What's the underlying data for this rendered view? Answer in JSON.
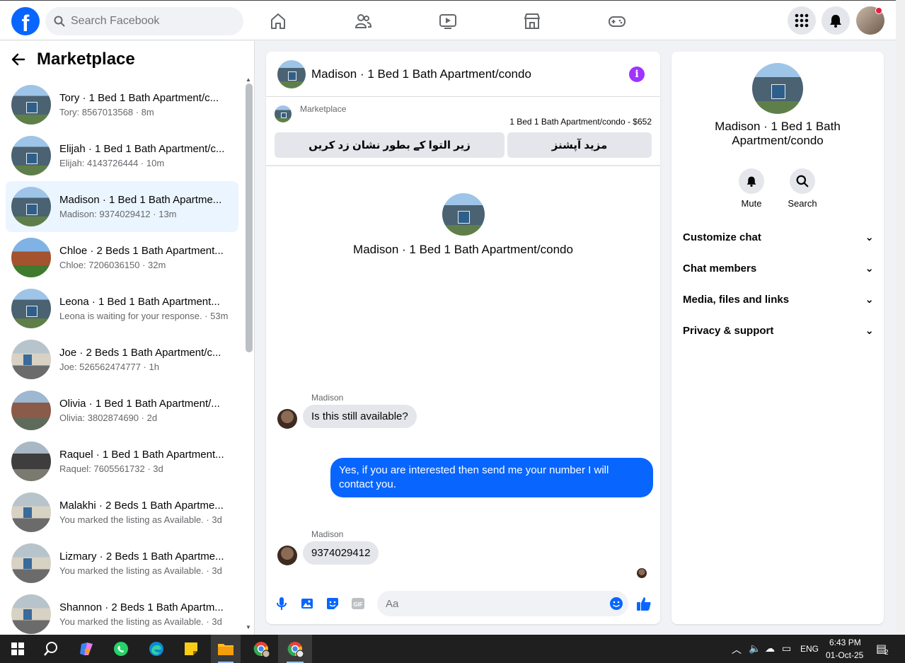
{
  "topbar": {
    "search_placeholder": "Search Facebook",
    "nav_icons": [
      "home-icon",
      "friends-icon",
      "video-icon",
      "marketplace-icon",
      "gaming-icon"
    ],
    "brand_color": "#0866ff"
  },
  "sidebar": {
    "title": "Marketplace",
    "conversations": [
      {
        "title": "Tory · 1 Bed 1 Bath Apartment/c...",
        "sub": "Tory: 8567013568 · 8m"
      },
      {
        "title": "Elijah · 1 Bed 1 Bath Apartment/c...",
        "sub": "Elijah: 4143726444 · 10m"
      },
      {
        "title": "Madison · 1 Bed 1 Bath Apartme...",
        "sub": "Madison: 9374029412 · 13m"
      },
      {
        "title": "Chloe · 2 Beds 1 Bath Apartment...",
        "sub": "Chloe: 7206036150 · 32m"
      },
      {
        "title": "Leona  · 1 Bed 1 Bath Apartment...",
        "sub": "Leona is waiting for your response. · 53m"
      },
      {
        "title": "Joe · 2 Beds 1 Bath Apartment/c...",
        "sub": "Joe: 526562474777 · 1h"
      },
      {
        "title": "Olivia · 1 Bed 1 Bath Apartment/...",
        "sub": "Olivia: 3802874690 · 2d"
      },
      {
        "title": "Raquel · 1 Bed 1 Bath Apartment...",
        "sub": "Raquel: 7605561732 · 3d"
      },
      {
        "title": "Malakhi · 2 Beds 1 Bath Apartme...",
        "sub": "You marked the listing as Available. · 3d"
      },
      {
        "title": "Lizmary · 2 Beds 1 Bath Apartme...",
        "sub": "You marked the listing as Available. · 3d"
      },
      {
        "title": "Shannon · 2 Beds 1 Bath Apartm...",
        "sub": "You marked the listing as Available. · 3d"
      }
    ]
  },
  "chat": {
    "header_name": "Madison · 1 Bed 1 Bath Apartment/condo",
    "listing_source": "Marketplace",
    "listing_price": "1 Bed 1 Bath Apartment/condo - $652",
    "btn_more_options": "مزید آپشنز",
    "btn_mark_pending": "زیر التوا کے بطور نشان زد کریں",
    "center_name": "Madison · 1 Bed 1 Bath Apartment/condo",
    "messages": [
      {
        "sender": "Madison",
        "text": "Is this still available?"
      },
      {
        "sender": "You",
        "text": "Yes, if you are interested then send me your number I will contact you."
      },
      {
        "sender": "Madison",
        "text": "9374029412"
      }
    ],
    "input_placeholder": "Aa"
  },
  "details": {
    "name": "Madison · 1 Bed 1 Bath Apartment/condo",
    "mute_label": "Mute",
    "search_label": "Search",
    "rows": [
      "Customize chat",
      "Chat members",
      "Media, files and links",
      "Privacy & support"
    ]
  },
  "taskbar": {
    "lang": "ENG",
    "time": "6:43 PM",
    "date": "01-Oct-25",
    "notif_count": "2"
  }
}
